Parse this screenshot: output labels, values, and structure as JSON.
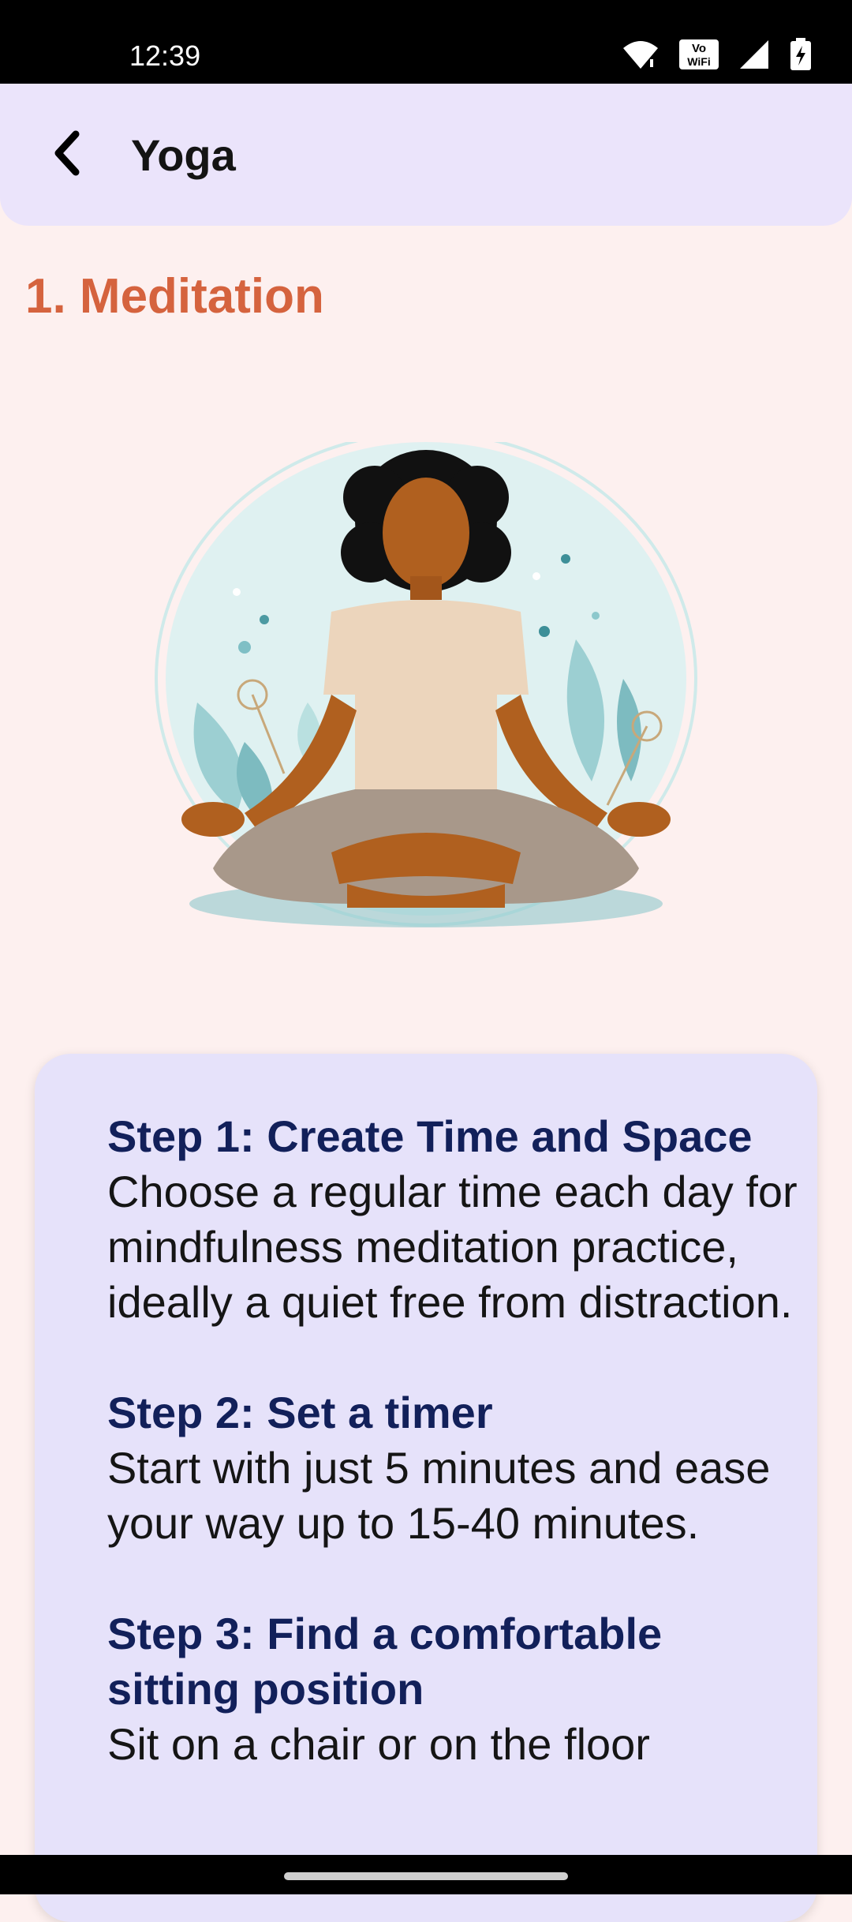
{
  "status_bar": {
    "time": "12:39",
    "icons": [
      "wifi-icon",
      "vowifi-icon",
      "signal-icon",
      "battery-charging-icon"
    ],
    "vowifi_top": "Vo",
    "vowifi_bottom": "WiFi"
  },
  "app_bar": {
    "back_icon": "chevron-left-icon",
    "title": "Yoga"
  },
  "section": {
    "title": "1. Meditation"
  },
  "illustration": {
    "subject": "woman-meditating-illustration"
  },
  "steps": [
    {
      "title": "Step 1: Create Time and Space",
      "body": "Choose a regular time each day for mindfulness meditation practice, ideally a quiet free from distraction."
    },
    {
      "title": "Step 2: Set a timer",
      "body": "Start with just 5 minutes and ease your way up to 15-40 minutes."
    },
    {
      "title": "Step 3: Find a comfortable sitting position",
      "body": "Sit on a chair or on the floor"
    }
  ],
  "colors": {
    "background": "#fdf0ef",
    "app_bar": "#ebe4fb",
    "accent_title": "#d5633e",
    "step_title": "#12205a",
    "card": "#e6e2fa"
  }
}
